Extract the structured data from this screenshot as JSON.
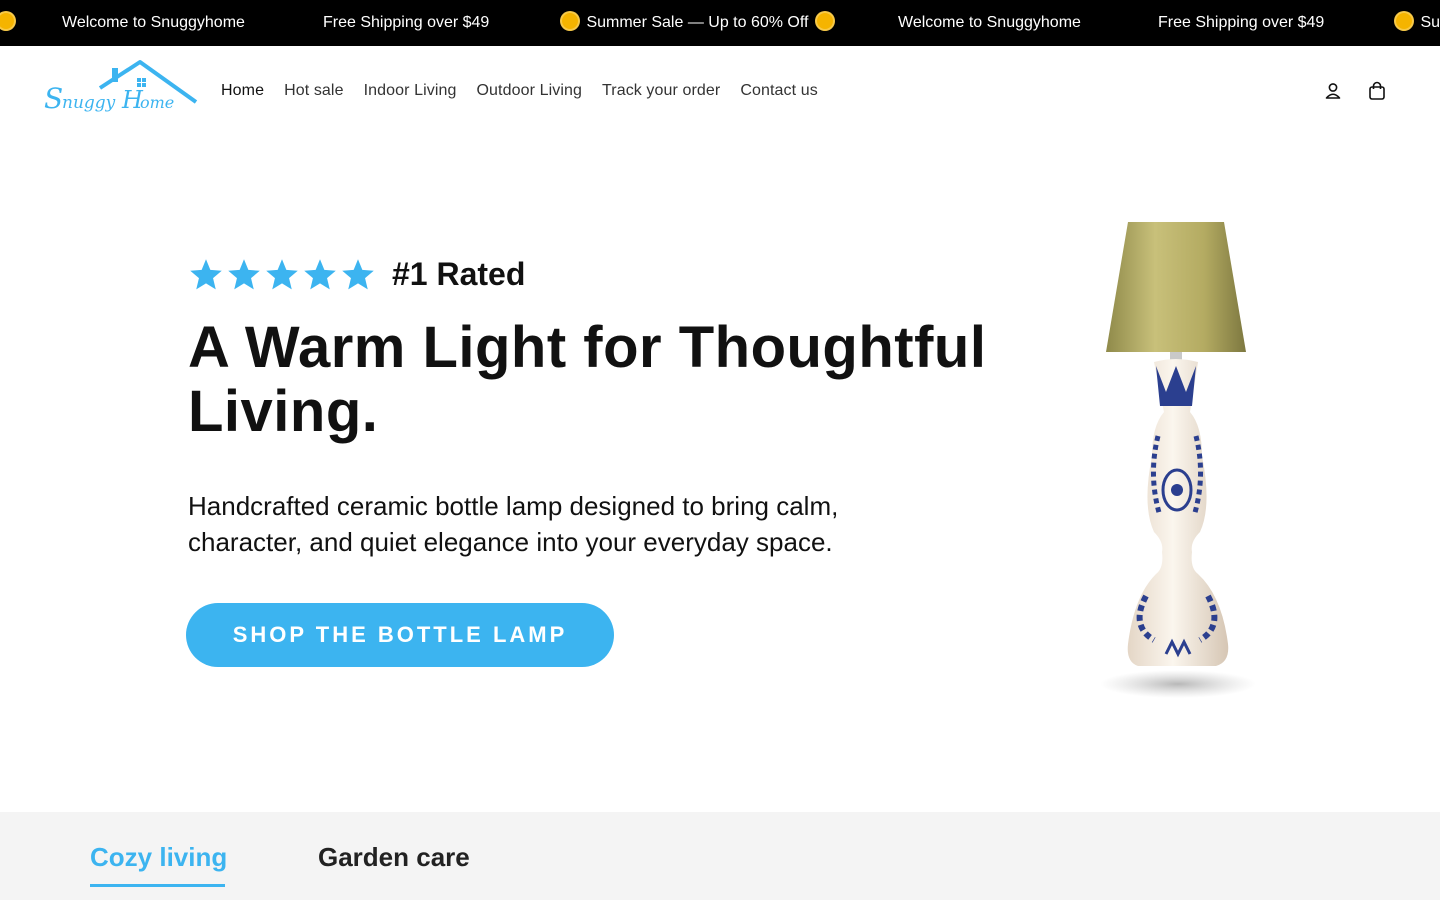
{
  "announcement": {
    "items": [
      {
        "text": "Welcome to Snuggyhome",
        "icon": null
      },
      {
        "text": "Free Shipping over $49",
        "icon": null
      },
      {
        "text": "Summer Sale — Up to 60% Off",
        "icon": "sun-icon"
      },
      {
        "text": "Welcome to Snuggyhome",
        "icon": null
      },
      {
        "text": "Free Shipping over $49",
        "icon": null
      },
      {
        "text": "Sum",
        "icon": "sun-icon"
      }
    ]
  },
  "header": {
    "logo_text": "SnuggyHome",
    "nav": [
      {
        "label": "Home"
      },
      {
        "label": "Hot sale"
      },
      {
        "label": "Indoor Living"
      },
      {
        "label": "Outdoor Living"
      },
      {
        "label": "Track your order"
      },
      {
        "label": "Contact us"
      }
    ],
    "icons": {
      "account": "account-icon",
      "cart": "cart-icon"
    }
  },
  "hero": {
    "rating_stars": 5,
    "rating_label": "#1 Rated",
    "headline": "A Warm Light for Thoughtful Living.",
    "subtext": "Handcrafted ceramic bottle lamp designed to bring calm, character, and quiet elegance into your everyday space.",
    "cta_label": "SHOP THE BOTTLE LAMP",
    "accent_color": "#3cb4f0"
  },
  "tabs": {
    "items": [
      {
        "label": "Cozy living",
        "active": true
      },
      {
        "label": "Garden care",
        "active": false
      }
    ]
  }
}
